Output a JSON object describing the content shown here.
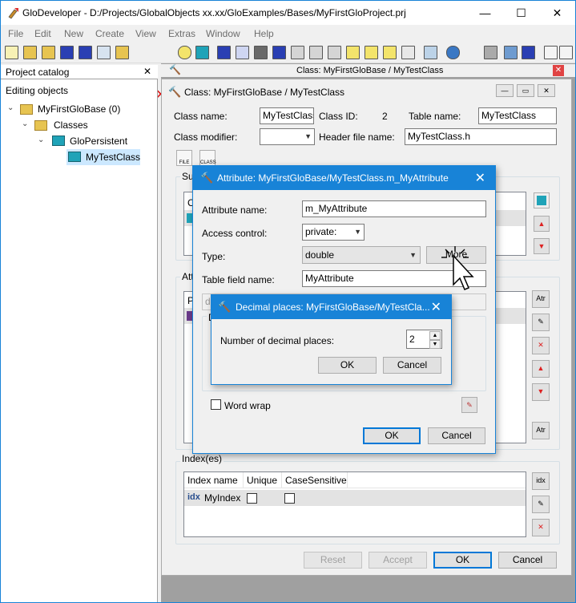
{
  "app": {
    "title": "GloDeveloper - D:/Projects/GlobalObjects xx.xx/GloExamples/Bases/MyFirstGloProject.prj",
    "minimize": "—",
    "maximize": "☐",
    "close": "✕"
  },
  "menu": [
    "File",
    "Edit",
    "New",
    "Create",
    "View",
    "Extras",
    "Window",
    "Help"
  ],
  "project_catalog": {
    "title": "Project catalog",
    "close": "✕",
    "section": "Editing objects",
    "tree": [
      {
        "label": "MyFirstGloBase (0)"
      },
      {
        "label": "Classes"
      },
      {
        "label": "GloPersistent"
      },
      {
        "label": "MyTestClass"
      }
    ]
  },
  "mdi_tab": {
    "title": "Class: MyFirstGloBase / MyTestClass",
    "close": "✕"
  },
  "class_window": {
    "title": "Class: MyFirstGloBase / MyTestClass",
    "class_name_label": "Class name:",
    "class_name": "MyTestClass",
    "class_id_label": "Class ID:",
    "class_id": "2",
    "table_name_label": "Table name:",
    "table_name": "MyTestClass",
    "class_modifier_label": "Class modifier:",
    "class_modifier": "",
    "header_file_label": "Header file name:",
    "header_file": "MyTestClass.h",
    "file_btn": "FILE",
    "class_btn": "CLASS",
    "superclass_group_partial": "Su",
    "superclass_row_partial": "C",
    "attributes_group_partial": "Att",
    "attributes_row_partial": "P",
    "index_group": "Index(es)",
    "index_columns": [
      "Index name",
      "Unique",
      "CaseSensitive"
    ],
    "index_rows": [
      {
        "prefix": "idx",
        "name": "MyIndex"
      }
    ],
    "buttons": {
      "reset": "Reset",
      "accept": "Accept",
      "ok": "OK",
      "cancel": "Cancel"
    }
  },
  "attribute_dialog": {
    "title": "Attribute: MyFirstGloBase/MyTestClass.m_MyAttribute",
    "close": "✕",
    "attr_name_label": "Attribute name:",
    "attr_name": "m_MyAttribute",
    "access_label": "Access control:",
    "access_value": "private:",
    "type_label": "Type:",
    "type_value": "double",
    "more_button": "More",
    "table_field_label": "Table field name:",
    "table_field": "MyAttribute",
    "partial_field": "do",
    "partial_group": "D",
    "word_wrap_label": "Word wrap",
    "ok": "OK",
    "cancel": "Cancel"
  },
  "decimal_dialog": {
    "title": "Decimal places: MyFirstGloBase/MyTestCla...",
    "close": "✕",
    "label": "Number of decimal places:",
    "value": "2",
    "ok": "OK",
    "cancel": "Cancel"
  },
  "colors": {
    "accent": "#1883d7",
    "mdi_bg": "#a0a0a0",
    "selection": "#cce8ff",
    "teal_icon": "#1fa3b8",
    "folder": "#e7c451"
  }
}
